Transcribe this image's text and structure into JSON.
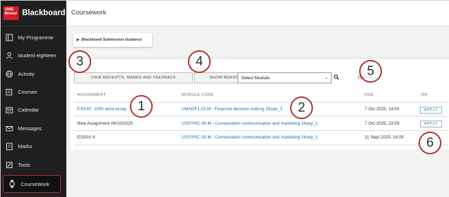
{
  "brand": {
    "logo_text": "UWE Bristol",
    "name": "Blackboard"
  },
  "sidebar": {
    "items": [
      {
        "label": "My Programme",
        "icon": "programme-icon"
      },
      {
        "label": "student eighteen",
        "icon": "user-icon"
      },
      {
        "label": "Activity",
        "icon": "globe-icon"
      },
      {
        "label": "Courses",
        "icon": "courses-icon"
      },
      {
        "label": "Calendar",
        "icon": "calendar-icon"
      },
      {
        "label": "Messages",
        "icon": "envelope-icon"
      },
      {
        "label": "Marks",
        "icon": "marks-icon"
      },
      {
        "label": "Tools",
        "icon": "tools-icon"
      },
      {
        "label": "CourseWork",
        "icon": "coursework-icon",
        "active": true
      }
    ]
  },
  "page": {
    "title": "Coursework"
  },
  "guidance": {
    "label": "Blackboard Submission Guidance"
  },
  "toolbar": {
    "receipts_label": "VIEW RECEIPTS, MARKS AND FEEDBACK",
    "adjustments_label": "SHOW REASONABLE ADJUSTMENTS",
    "module_select": "Select Module",
    "options_label": "Options"
  },
  "table": {
    "headers": {
      "assignment": "ASSIGNMENT",
      "module": "MODULE CODE",
      "due": "DUE",
      "ra": "RA"
    },
    "rows": [
      {
        "assignment": "ESSAY: 1000 word essay",
        "module": "UMADFJ-15-M - Financial decision making 25sep_3",
        "due": "7 Oct 2025, 14:00",
        "ra": "APPLY"
      },
      {
        "assignment": "New Assignment 06/10/2025",
        "module": "USSYHC-30-M - Conservation communication and marketing 24sep_1",
        "due": "7 Oct 2025, 23:59",
        "ra": "APPLY"
      },
      {
        "assignment": "ESSAY 4",
        "module": "USSYHC-30-M - Conservation communication and marketing 24sep_1",
        "due": "11 Sept 2025, 14:00",
        "ra": ""
      }
    ]
  },
  "callouts": [
    "1",
    "2",
    "3",
    "4",
    "5",
    "6"
  ],
  "colors": {
    "sidebar_bg": "#1f1f1f",
    "accent_red": "#b0312c",
    "link": "#1b6ca8"
  }
}
